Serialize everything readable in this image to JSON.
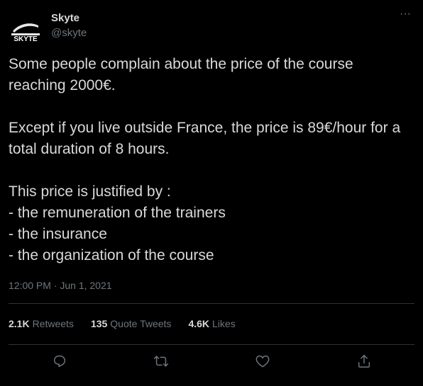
{
  "author": {
    "display_name": "Skyte",
    "handle": "@skyte",
    "avatar_text": "SKYTE"
  },
  "tweet": {
    "paragraphs": [
      "Some people complain about the price of the course reaching 2000€.",
      "Except if you live outside France, the price is 89€/hour for a total duration of 8 hours.",
      "This price is justified by :\n- the remuneration of the trainers\n- the insurance\n- the organization of the course"
    ],
    "timestamp": "12:00 PM · Jun 1, 2021"
  },
  "stats": {
    "retweets_count": "2.1K",
    "retweets_label": "Retweets",
    "quotes_count": "135",
    "quotes_label": "Quote Tweets",
    "likes_count": "4.6K",
    "likes_label": "Likes"
  },
  "actions": {
    "icons": [
      "reply-icon",
      "retweet-icon",
      "like-icon",
      "share-icon"
    ]
  },
  "colors": {
    "background": "#000000",
    "text": "#d9d9d9",
    "secondary": "#6e767d",
    "divider": "#2f3336"
  }
}
